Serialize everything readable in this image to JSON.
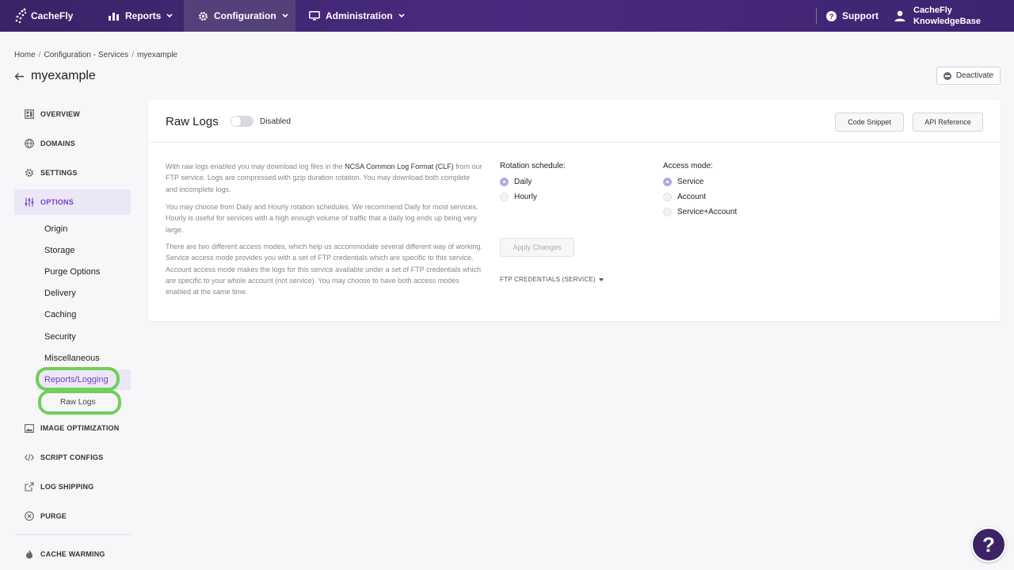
{
  "topnav": {
    "logo_text": "CacheFly",
    "items": [
      {
        "label": "Reports"
      },
      {
        "label": "Configuration"
      },
      {
        "label": "Administration"
      }
    ],
    "support": "Support",
    "user_line1": "CacheFly",
    "user_line2": "KnowledgeBase"
  },
  "breadcrumb": [
    "Home",
    "Configuration - Services",
    "myexample"
  ],
  "breadcrumb_sep": "/",
  "page_title": "myexample",
  "deactivate_label": "Deactivate",
  "sidebar": {
    "top_items": [
      {
        "label": "OVERVIEW"
      },
      {
        "label": "DOMAINS"
      },
      {
        "label": "SETTINGS"
      },
      {
        "label": "OPTIONS"
      },
      {
        "label": "IMAGE OPTIMIZATION"
      },
      {
        "label": "SCRIPT CONFIGS"
      },
      {
        "label": "LOG SHIPPING"
      },
      {
        "label": "PURGE"
      },
      {
        "label": "CACHE WARMING"
      }
    ],
    "sub_items": [
      "Origin",
      "Storage",
      "Purge Options",
      "Delivery",
      "Caching",
      "Security",
      "Miscellaneous",
      "Reports/Logging"
    ],
    "subsub_item": "Raw Logs"
  },
  "card": {
    "title": "Raw Logs",
    "toggle_state": "Disabled",
    "code_snippet": "Code Snippet",
    "api_reference": "API Reference",
    "desc1_a": "With raw logs enabled you may download log files in the ",
    "desc1_em": "NCSA Common Log Format (CLF)",
    "desc1_b": " from our FTP service. Logs are compressed with gzip duration rotation. You may download both complete and incomplete logs.",
    "desc2": "You may choose from Daily and Hourly rotation schedules. We recommend Daily for most services. Hourly is useful for services with a high enough volume of traffic that a daily log ends up being very large.",
    "desc3": "There are two different access modes, which help us accommodate several different way of working. Service access mode provides you with a set of FTP credentials which are specific to this service. Account access mode makes the logs for this service available under a set of FTP credentials which are specific to your whole account (not service). You may choose to have both access modes enabled at the same time.",
    "rotation_label": "Rotation schedule:",
    "rotation_options": [
      "Daily",
      "Hourly"
    ],
    "rotation_selected": "Daily",
    "access_label": "Access mode:",
    "access_options": [
      "Service",
      "Account",
      "Service+Account"
    ],
    "access_selected": "Service",
    "apply_label": "Apply Changes",
    "ftp_label": "FTP CREDENTIALS (SERVICE)"
  },
  "help_label": "?",
  "colors": {
    "nav_bg": "#3b2366",
    "accent": "#7a3fc4",
    "highlight_ring": "#6fd05a"
  }
}
